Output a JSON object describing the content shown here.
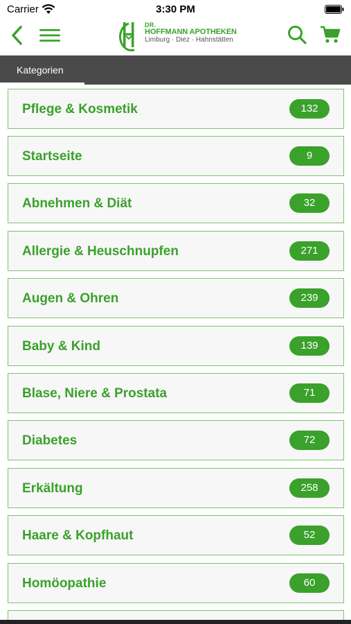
{
  "status": {
    "carrier": "Carrier",
    "time": "3:30 PM"
  },
  "nav": {
    "back_icon": "chevron-left-icon",
    "menu_icon": "hamburger-menu-icon",
    "search_icon": "search-icon",
    "cart_icon": "shopping-cart-icon"
  },
  "logo": {
    "line1": "DR.",
    "line2": "HOFFMANN APOTHEKEN",
    "line3": "Limburg · Diez · Hahnstätten"
  },
  "tabs": {
    "active": "Kategorien"
  },
  "colors": {
    "accent": "#3aa12b",
    "border": "#7bc46b",
    "tabbar": "#4a4a4a"
  },
  "categories": [
    {
      "label": "Pflege & Kosmetik",
      "count": "132"
    },
    {
      "label": "Startseite",
      "count": "9"
    },
    {
      "label": "Abnehmen & Diät",
      "count": "32"
    },
    {
      "label": "Allergie & Heuschnupfen",
      "count": "271"
    },
    {
      "label": "Augen & Ohren",
      "count": "239"
    },
    {
      "label": "Baby & Kind",
      "count": "139"
    },
    {
      "label": "Blase, Niere & Prostata",
      "count": "71"
    },
    {
      "label": "Diabetes",
      "count": "72"
    },
    {
      "label": "Erkältung",
      "count": "258"
    },
    {
      "label": "Haare & Kopfhaut",
      "count": "52"
    },
    {
      "label": "Homöopathie",
      "count": "60"
    }
  ]
}
